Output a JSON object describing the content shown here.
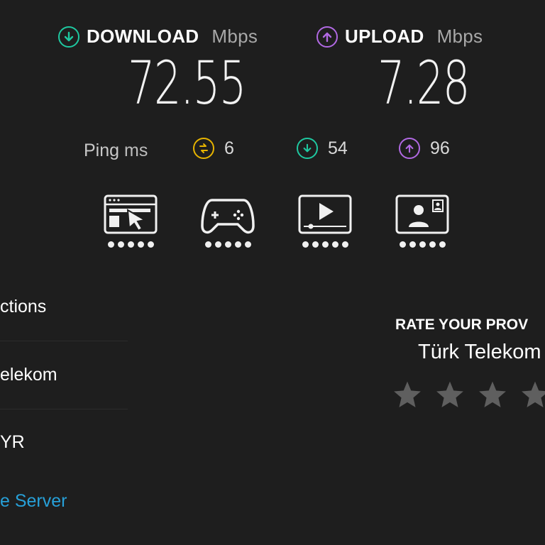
{
  "download": {
    "label": "DOWNLOAD",
    "unit": "Mbps",
    "value": "72.55",
    "color": "#1ec8a0"
  },
  "upload": {
    "label": "UPLOAD",
    "unit": "Mbps",
    "value": "7.28",
    "color": "#b169e3"
  },
  "ping": {
    "label": "Ping",
    "unit": "ms",
    "idle": {
      "value": "6",
      "icon": "idle-ping-icon",
      "color": "#e7b400"
    },
    "download": {
      "value": "54",
      "icon": "download-ping-icon",
      "color": "#1ec8a0"
    },
    "upload": {
      "value": "96",
      "icon": "upload-ping-icon",
      "color": "#b169e3"
    }
  },
  "use_cases": [
    {
      "name": "web-browsing-icon",
      "rating": 5
    },
    {
      "name": "gaming-icon",
      "rating": 5
    },
    {
      "name": "video-streaming-icon",
      "rating": 5
    },
    {
      "name": "video-call-icon",
      "rating": 5
    }
  ],
  "left_list": {
    "connections": "ctions",
    "provider": "elekom",
    "location": "YR",
    "change_server": "e Server"
  },
  "rate": {
    "title": "RATE YOUR PROV",
    "provider": "Türk Telekom",
    "stars": 5,
    "star_color": "#5f5f5f"
  },
  "colors": {
    "background": "#1e1e1e",
    "link": "#27a0d8"
  }
}
